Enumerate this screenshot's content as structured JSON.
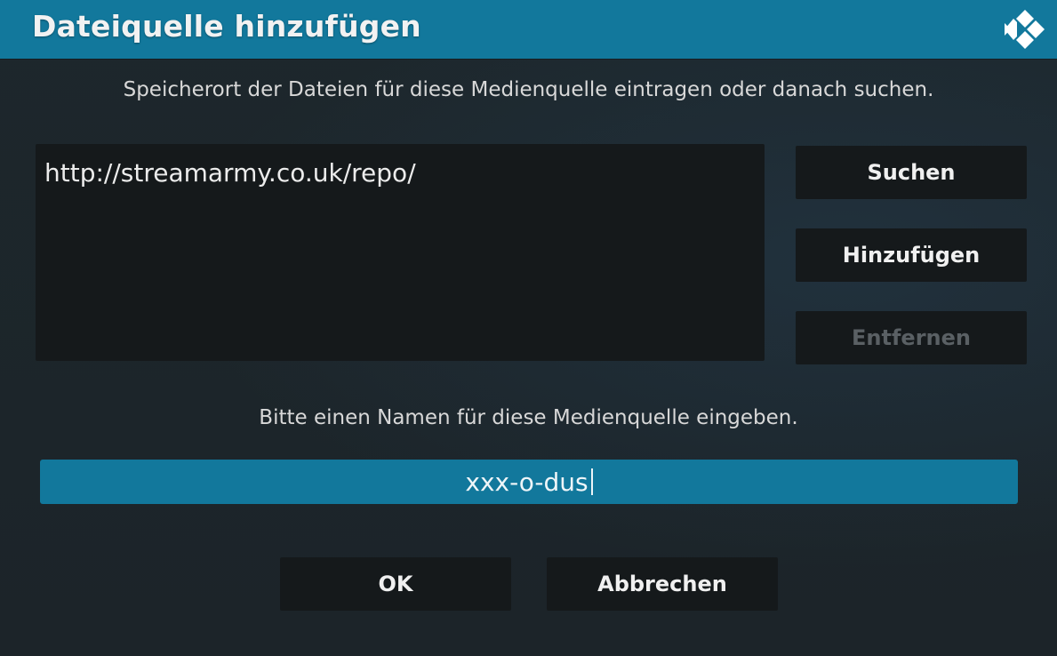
{
  "dialog": {
    "title": "Dateiquelle hinzufügen",
    "logo_icon": "kodi-logo-icon"
  },
  "location": {
    "instruction": "Speicherort der Dateien für diese Medienquelle eintragen oder danach suchen.",
    "paths": [
      "http://streamarmy.co.uk/repo/"
    ]
  },
  "side_buttons": {
    "browse": "Suchen",
    "add": "Hinzufügen",
    "remove": "Entfernen",
    "remove_enabled": false
  },
  "name": {
    "instruction": "Bitte einen Namen für diese Medienquelle eingeben.",
    "value": "xxx-o-dus"
  },
  "footer": {
    "ok": "OK",
    "cancel": "Abbrechen"
  },
  "colors": {
    "accent": "#12789c",
    "background": "#1f2a30",
    "panel": "#15191b",
    "disabled_text": "#5a6064"
  }
}
